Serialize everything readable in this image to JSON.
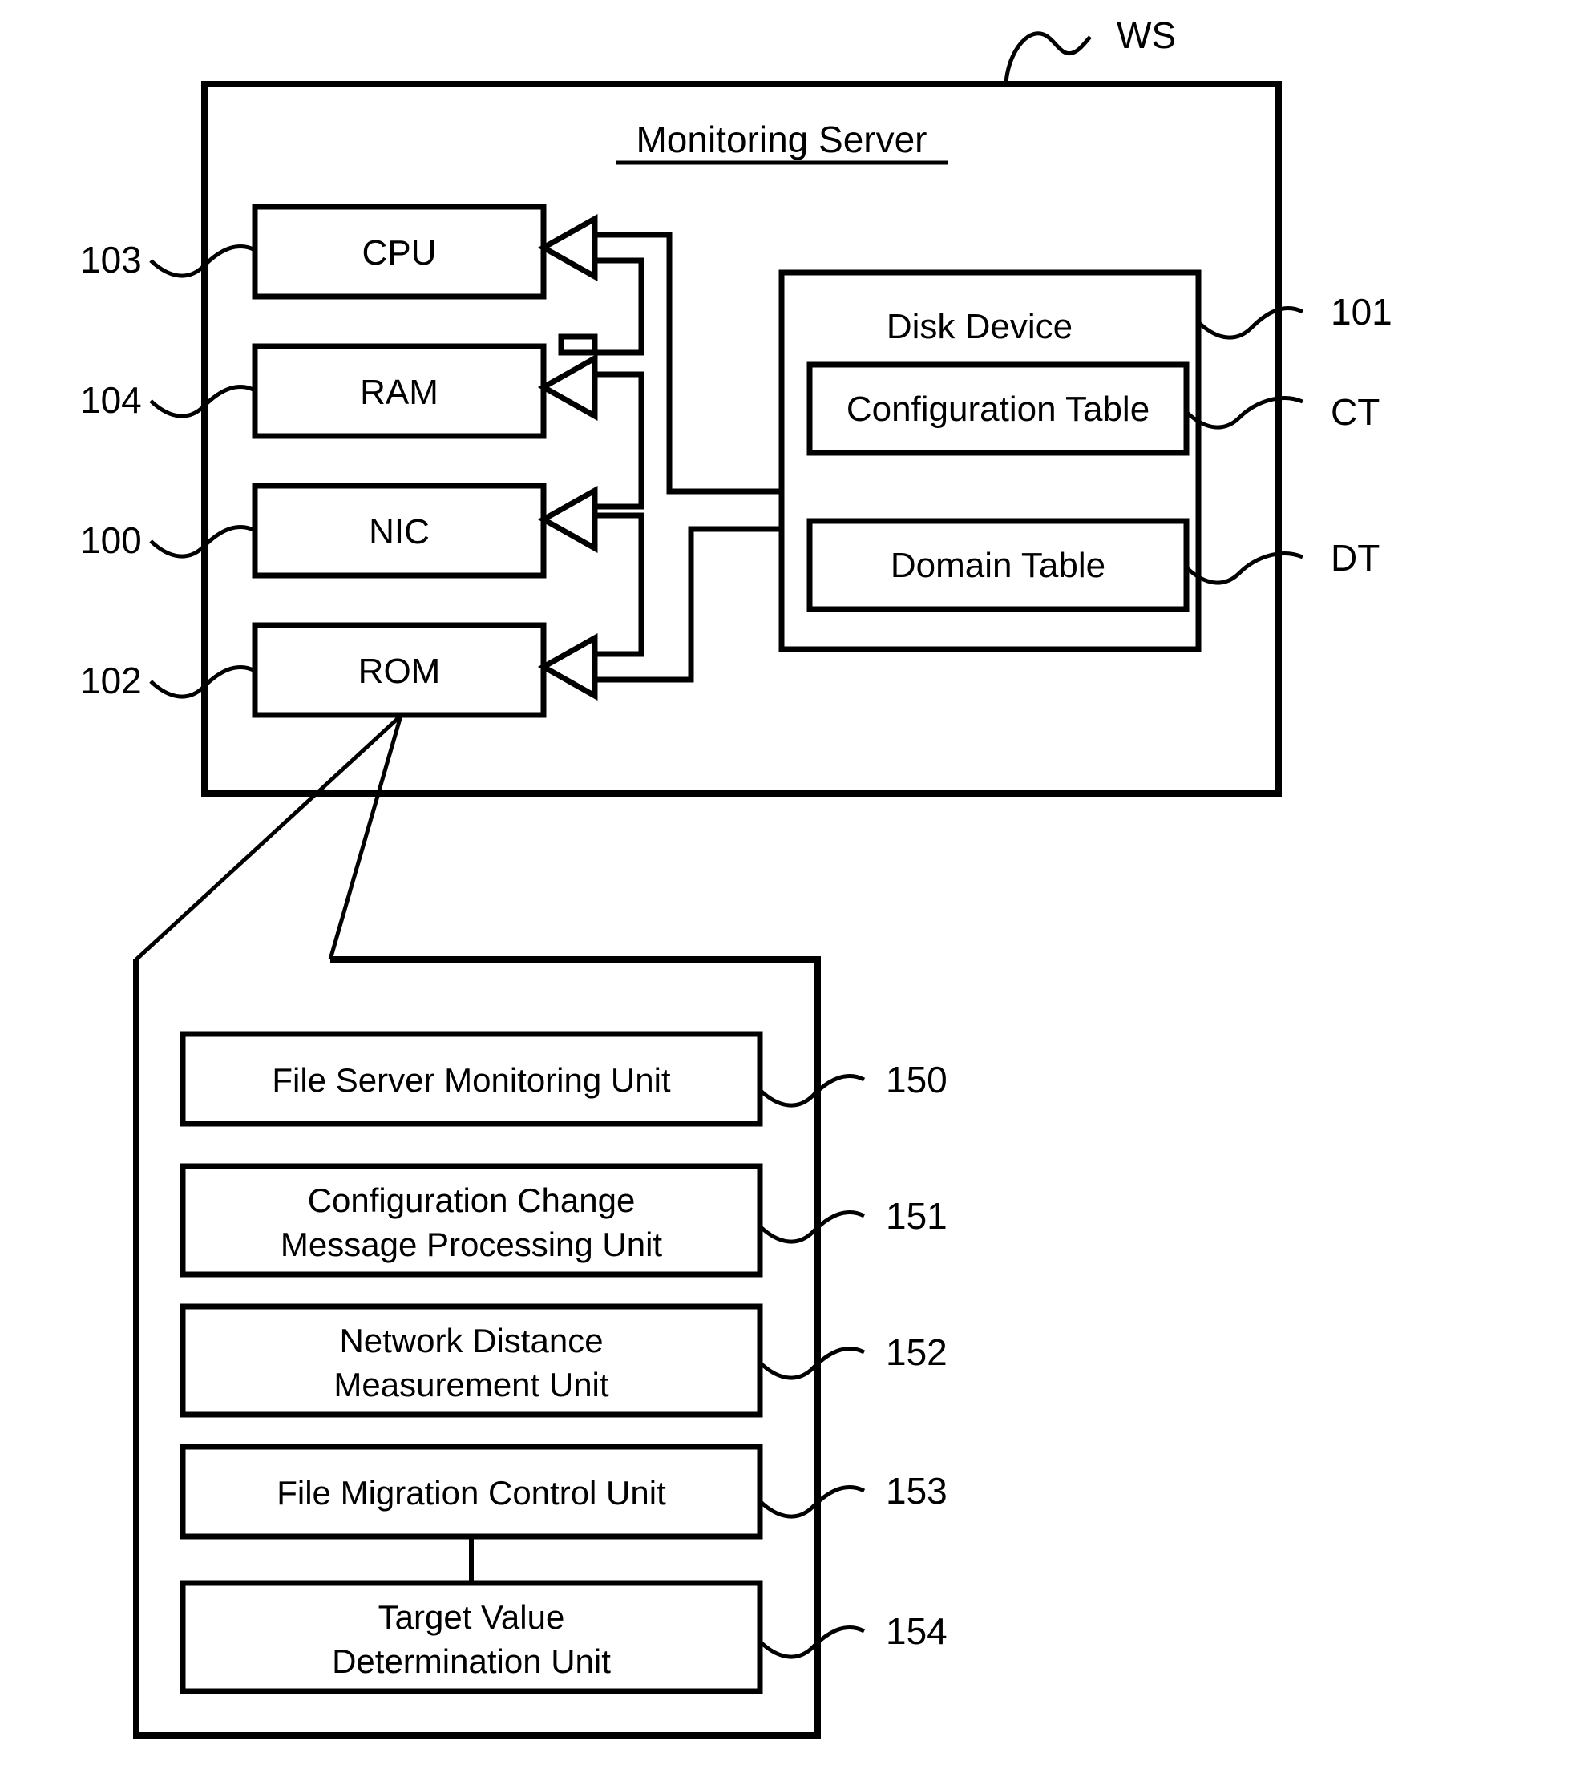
{
  "figure": {
    "type": "patent-block-diagram",
    "outer": {
      "title": "Monitoring Server",
      "reference_label": "WS"
    },
    "hardware_components": [
      {
        "label": "CPU",
        "ref": "103"
      },
      {
        "label": "RAM",
        "ref": "104"
      },
      {
        "label": "NIC",
        "ref": "100"
      },
      {
        "label": "ROM",
        "ref": "102"
      }
    ],
    "disk_device": {
      "label": "Disk Device",
      "ref": "101",
      "tables": [
        {
          "label": "Configuration Table",
          "ref": "CT"
        },
        {
          "label": "Domain Table",
          "ref": "DT"
        }
      ]
    },
    "rom_detail": {
      "units": [
        {
          "label": "File Server Monitoring Unit",
          "ref": "150",
          "lines": [
            "File Server Monitoring Unit"
          ]
        },
        {
          "label": "Configuration Change Message Processing Unit",
          "ref": "151",
          "lines": [
            "Configuration Change",
            "Message Processing Unit"
          ]
        },
        {
          "label": "Network Distance Measurement Unit",
          "ref": "152",
          "lines": [
            "Network Distance",
            "Measurement Unit"
          ]
        },
        {
          "label": "File Migration Control Unit",
          "ref": "153",
          "lines": [
            "File Migration Control Unit"
          ]
        },
        {
          "label": "Target Value Determination Unit",
          "ref": "154",
          "lines": [
            "Target Value",
            "Determination Unit"
          ]
        }
      ]
    },
    "colors": {
      "ink": "#000000",
      "paper": "#ffffff"
    }
  }
}
